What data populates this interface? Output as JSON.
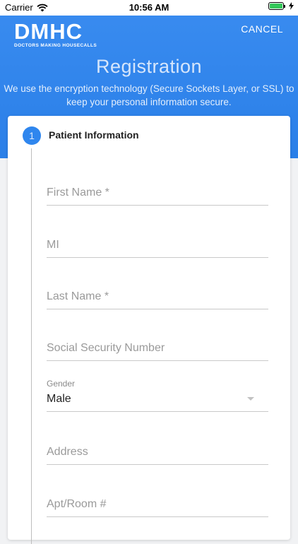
{
  "status_bar": {
    "carrier": "Carrier",
    "time": "10:56 AM"
  },
  "header": {
    "logo_mark": "DMHC",
    "logo_tagline": "DOCTORS MAKING HOUSECALLS",
    "cancel_label": "CANCEL",
    "title": "Registration",
    "description_line1": "We use the encryption technology (Secure Sockets Layer, or SSL) to",
    "description_line2": "keep your personal information secure.",
    "background_color": "#2f86ee"
  },
  "step": {
    "number": "1",
    "title": "Patient Information"
  },
  "form": {
    "first_name_placeholder": "First Name *",
    "mi_placeholder": "MI",
    "last_name_placeholder": "Last Name *",
    "ssn_placeholder": "Social Security Number",
    "gender_label": "Gender",
    "gender_value": "Male",
    "address_placeholder": "Address",
    "apt_placeholder": "Apt/Room #"
  }
}
